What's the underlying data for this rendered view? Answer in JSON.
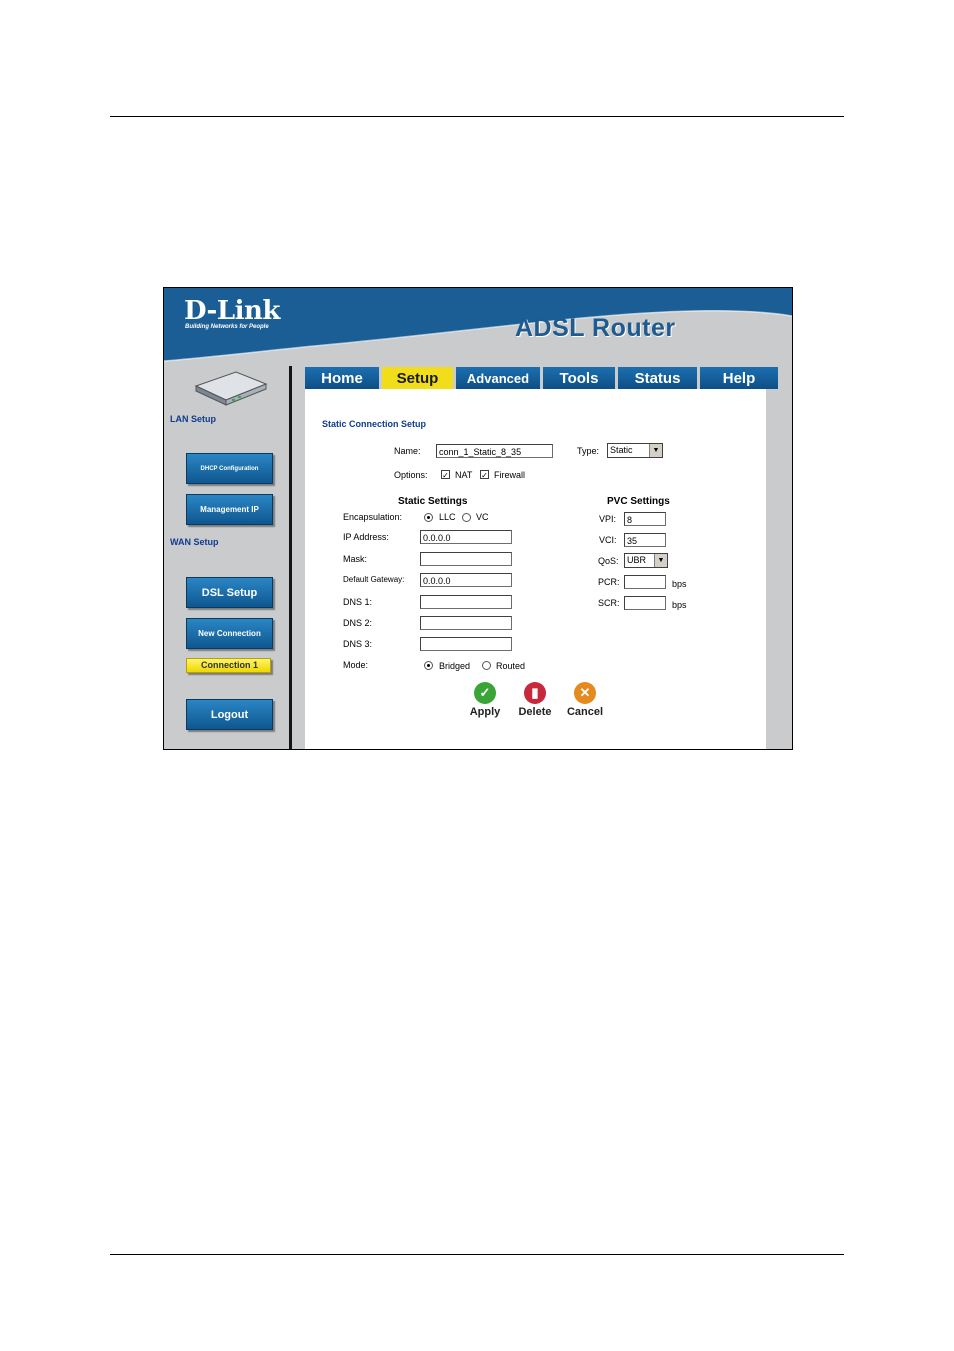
{
  "header": {
    "logo": "D-Link",
    "tagline": "Building Networks for People",
    "product": "ADSL Router"
  },
  "sidebar": {
    "lan_title": "LAN Setup",
    "wan_title": "WAN Setup",
    "buttons": [
      "DHCP Configuration",
      "Management IP",
      "DSL Setup",
      "New Connection",
      "Connection 1",
      "Logout"
    ],
    "selected": "Connection 1"
  },
  "tabs": [
    "Home",
    "Setup",
    "Advanced",
    "Tools",
    "Status",
    "Help"
  ],
  "active_tab": "Setup",
  "form": {
    "title": "Static Connection Setup",
    "name_label": "Name:",
    "name_value": "conn_1_Static_8_35",
    "type_label": "Type:",
    "type_value": "Static",
    "options_label": "Options:",
    "nat_label": "NAT",
    "nat_checked": true,
    "firewall_label": "Firewall",
    "firewall_checked": true,
    "static_title": "Static Settings",
    "encapsulation_label": "Encapsulation:",
    "encap_llc": "LLC",
    "encap_vc": "VC",
    "encap_selected": "LLC",
    "ip_label": "IP Address:",
    "ip_value": "0.0.0.0",
    "mask_label": "Mask:",
    "mask_value": "",
    "gateway_label": "Default Gateway:",
    "gateway_value": "0.0.0.0",
    "dns1_label": "DNS 1:",
    "dns1_value": "",
    "dns2_label": "DNS 2:",
    "dns2_value": "",
    "dns3_label": "DNS 3:",
    "dns3_value": "",
    "mode_label": "Mode:",
    "mode_bridged": "Bridged",
    "mode_routed": "Routed",
    "mode_selected": "Bridged",
    "pvc_title": "PVC Settings",
    "vpi_label": "VPI:",
    "vpi_value": "8",
    "vci_label": "VCI:",
    "vci_value": "35",
    "qos_label": "QoS:",
    "qos_value": "UBR",
    "pcr_label": "PCR:",
    "pcr_value": "",
    "scr_label": "SCR:",
    "scr_value": "",
    "bps": "bps"
  },
  "actions": {
    "apply": "Apply",
    "delete": "Delete",
    "cancel": "Cancel"
  },
  "colors": {
    "brand_blue": "#1b5e96",
    "tab_active": "#f2dd1b",
    "selected_nav": "#f5e53a",
    "apply_green": "#3aa536",
    "delete_red": "#c8283c",
    "cancel_orange": "#e58a1e"
  },
  "icons": {
    "router_image": "router-device-icon",
    "apply": "check-icon",
    "delete": "trash-icon",
    "cancel": "x-icon"
  }
}
